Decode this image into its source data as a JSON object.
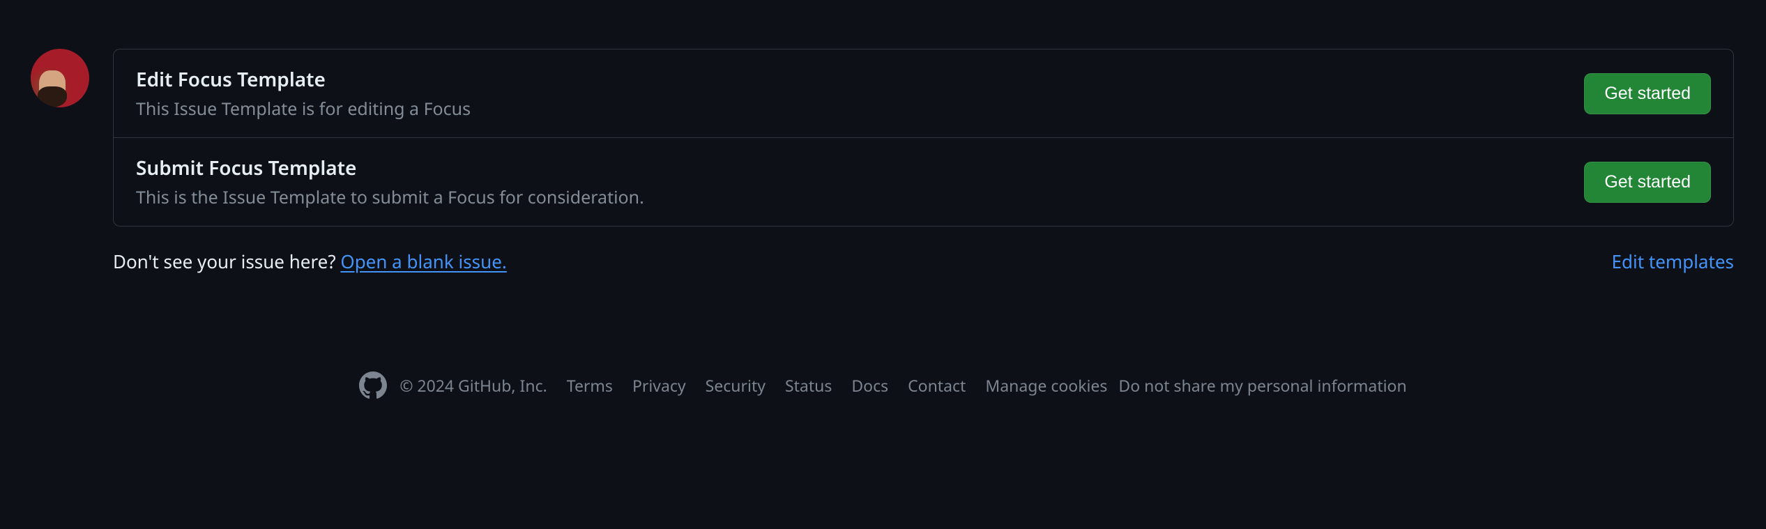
{
  "templates": [
    {
      "title": "Edit Focus Template",
      "description": "This Issue Template is for editing a Focus",
      "button": "Get started"
    },
    {
      "title": "Submit Focus Template",
      "description": "This is the Issue Template to submit a Focus for consideration.",
      "button": "Get started"
    }
  ],
  "blank_prompt": {
    "text": "Don't see your issue here? ",
    "link": "Open a blank issue."
  },
  "edit_templates": "Edit templates",
  "footer": {
    "copyright": "© 2024 GitHub, Inc.",
    "links": {
      "terms": "Terms",
      "privacy": "Privacy",
      "security": "Security",
      "status": "Status",
      "docs": "Docs",
      "contact": "Contact",
      "manage_cookies": "Manage cookies",
      "do_not_share": "Do not share my personal information"
    }
  }
}
